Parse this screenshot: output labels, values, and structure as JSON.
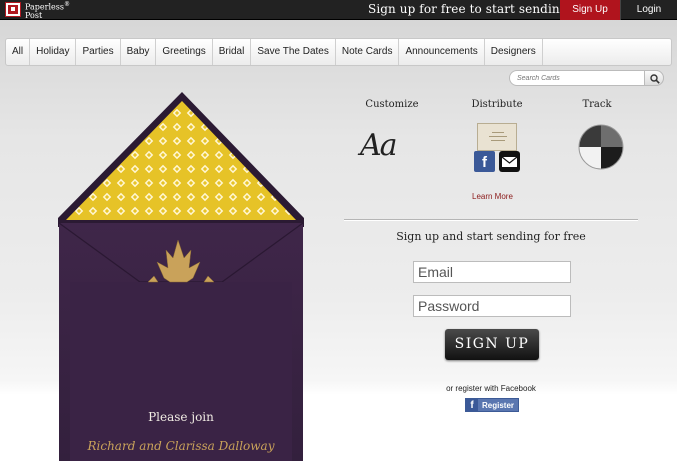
{
  "brand": {
    "name_line1": "Paperless",
    "name_line2": "Post",
    "mark": "®"
  },
  "topbar": {
    "tagline": "Sign up for free to start sending",
    "signup_label": "Sign Up",
    "login_label": "Login"
  },
  "nav": {
    "items": [
      "All",
      "Holiday",
      "Parties",
      "Baby",
      "Greetings",
      "Bridal",
      "Save The Dates",
      "Note Cards",
      "Announcements",
      "Designers"
    ]
  },
  "search": {
    "placeholder": "Search Cards",
    "icon": "search-icon"
  },
  "card": {
    "line1": "Please join",
    "line2": "Richard and Clarissa Dalloway",
    "envelope_color": "#3d2547",
    "liner_color": "#e6c327"
  },
  "features": {
    "customize": {
      "title": "Customize",
      "glyph": "Aa"
    },
    "distribute": {
      "title": "Distribute",
      "icons": [
        "facebook-icon",
        "email-icon"
      ]
    },
    "track": {
      "title": "Track",
      "icon": "pie-chart-icon"
    },
    "learn_more": "Learn More"
  },
  "signup_form": {
    "headline": "Sign up and start sending for free",
    "email_placeholder": "Email",
    "password_placeholder": "Password",
    "submit_label": "SIGN UP",
    "facebook_prompt": "or register with Facebook",
    "facebook_button": "Register",
    "facebook_glyph": "f"
  },
  "colors": {
    "accent": "#b0141d",
    "topbar": "#222222",
    "facebook": "#3b5998"
  }
}
